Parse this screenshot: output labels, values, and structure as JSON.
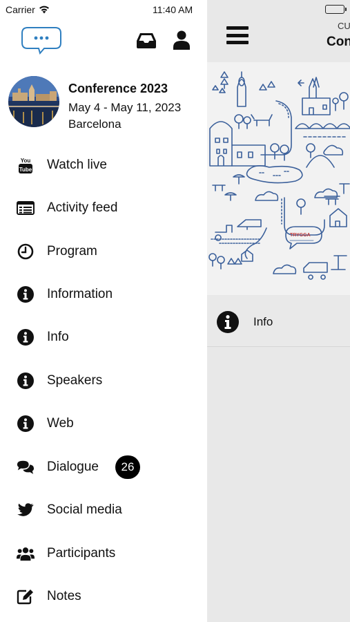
{
  "status_bar": {
    "carrier": "Carrier",
    "time": "11:40 AM"
  },
  "drawer": {
    "event": {
      "name": "Conference 2023",
      "dates": "May 4 - May 11, 2023",
      "location": "Barcelona"
    },
    "menu": [
      {
        "label": "Watch live",
        "icon": "youtube-icon"
      },
      {
        "label": "Activity feed",
        "icon": "newspaper-icon"
      },
      {
        "label": "Program",
        "icon": "clock-icon"
      },
      {
        "label": "Information",
        "icon": "info-icon"
      },
      {
        "label": "Info",
        "icon": "info-icon"
      },
      {
        "label": "Speakers",
        "icon": "info-icon"
      },
      {
        "label": "Web",
        "icon": "info-icon"
      },
      {
        "label": "Dialogue",
        "icon": "comments-icon",
        "badge": "26"
      },
      {
        "label": "Social media",
        "icon": "twitter-icon"
      },
      {
        "label": "Participants",
        "icon": "users-icon"
      },
      {
        "label": "Notes",
        "icon": "edit-icon"
      }
    ]
  },
  "main": {
    "subtitle": "CU",
    "title": "Con",
    "info_row_label": "Info",
    "banner_sign": "TRYGGA"
  },
  "colors": {
    "accent": "#2f7fc0",
    "illustration": "#3a5f9a",
    "badge": "#000000"
  }
}
